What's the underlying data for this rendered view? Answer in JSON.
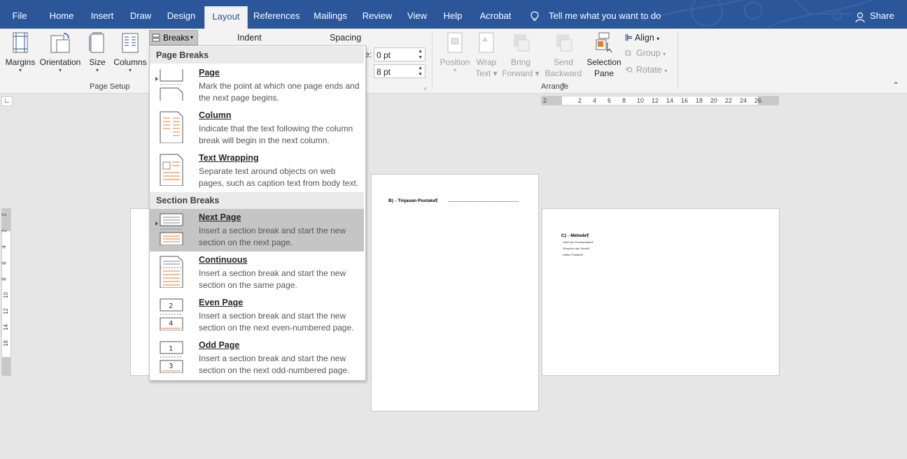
{
  "tabs": [
    "File",
    "Home",
    "Insert",
    "Draw",
    "Design",
    "Layout",
    "References",
    "Mailings",
    "Review",
    "View",
    "Help",
    "Acrobat"
  ],
  "tell_me": "Tell me what you want to do",
  "share": "Share",
  "ribbon": {
    "page_setup": {
      "margins": "Margins",
      "orientation": "Orientation",
      "size": "Size",
      "columns": "Columns",
      "breaks": "Breaks",
      "group_label": "Page Setup"
    },
    "paragraph": {
      "indent": "Indent",
      "spacing": "Spacing",
      "before_label": "e:",
      "before_value": "0 pt",
      "after_label": ":",
      "after_value": "8 pt"
    },
    "arrange": {
      "position": "Position",
      "wrap_text_1": "Wrap",
      "wrap_text_2": "Text",
      "bring_forward_1": "Bring",
      "bring_forward_2": "Forward",
      "send_backward_1": "Send",
      "send_backward_2": "Backward",
      "selection_pane_1": "Selection",
      "selection_pane_2": "Pane",
      "align": "Align",
      "group": "Group",
      "rotate": "Rotate",
      "group_label": "Arrange"
    }
  },
  "ruler": {
    "h_ticks": [
      "2",
      "2",
      "4",
      "6",
      "8",
      "10",
      "12",
      "14",
      "16",
      "18",
      "20",
      "22",
      "24",
      "26"
    ],
    "v_ticks": [
      "2",
      "2",
      "4",
      "6",
      "8",
      "10",
      "12",
      "14",
      "18"
    ]
  },
  "breaks_menu": {
    "page_breaks_header": "Page Breaks",
    "section_breaks_header": "Section Breaks",
    "items": [
      {
        "title": "Page",
        "desc": "Mark the point at which one page ends and the next page begins."
      },
      {
        "title": "Column",
        "desc": "Indicate that the text following the column break will begin in the next column."
      },
      {
        "title": "Text Wrapping",
        "desc": "Separate text around objects on web pages, such as caption text from body text."
      },
      {
        "title": "Next Page",
        "desc": "Insert a section break and start the new section on the next page."
      },
      {
        "title": "Continuous",
        "desc": "Insert a section break and start the new section on the same page."
      },
      {
        "title": "Even Page",
        "desc": "Insert a section break and start the new section on the next even-numbered page."
      },
      {
        "title": "Odd Page",
        "desc": "Insert a section break and start the new section on the next odd-numbered page."
      }
    ]
  },
  "document": {
    "page2_heading": "B)→Tinjauan·Pustaka¶",
    "page3_heading": "C)→Metode¶",
    "page3_lines": [
      "Hasil dan Pembahasan¶",
      "Simpulan dan Saran¶",
      "Daftar Pustaka¶"
    ]
  },
  "colors": {
    "brand": "#2b579a",
    "ribbon": "#f3f3f3",
    "highlight": "#c5c5c5",
    "icon_accent": "#e97c2e"
  }
}
